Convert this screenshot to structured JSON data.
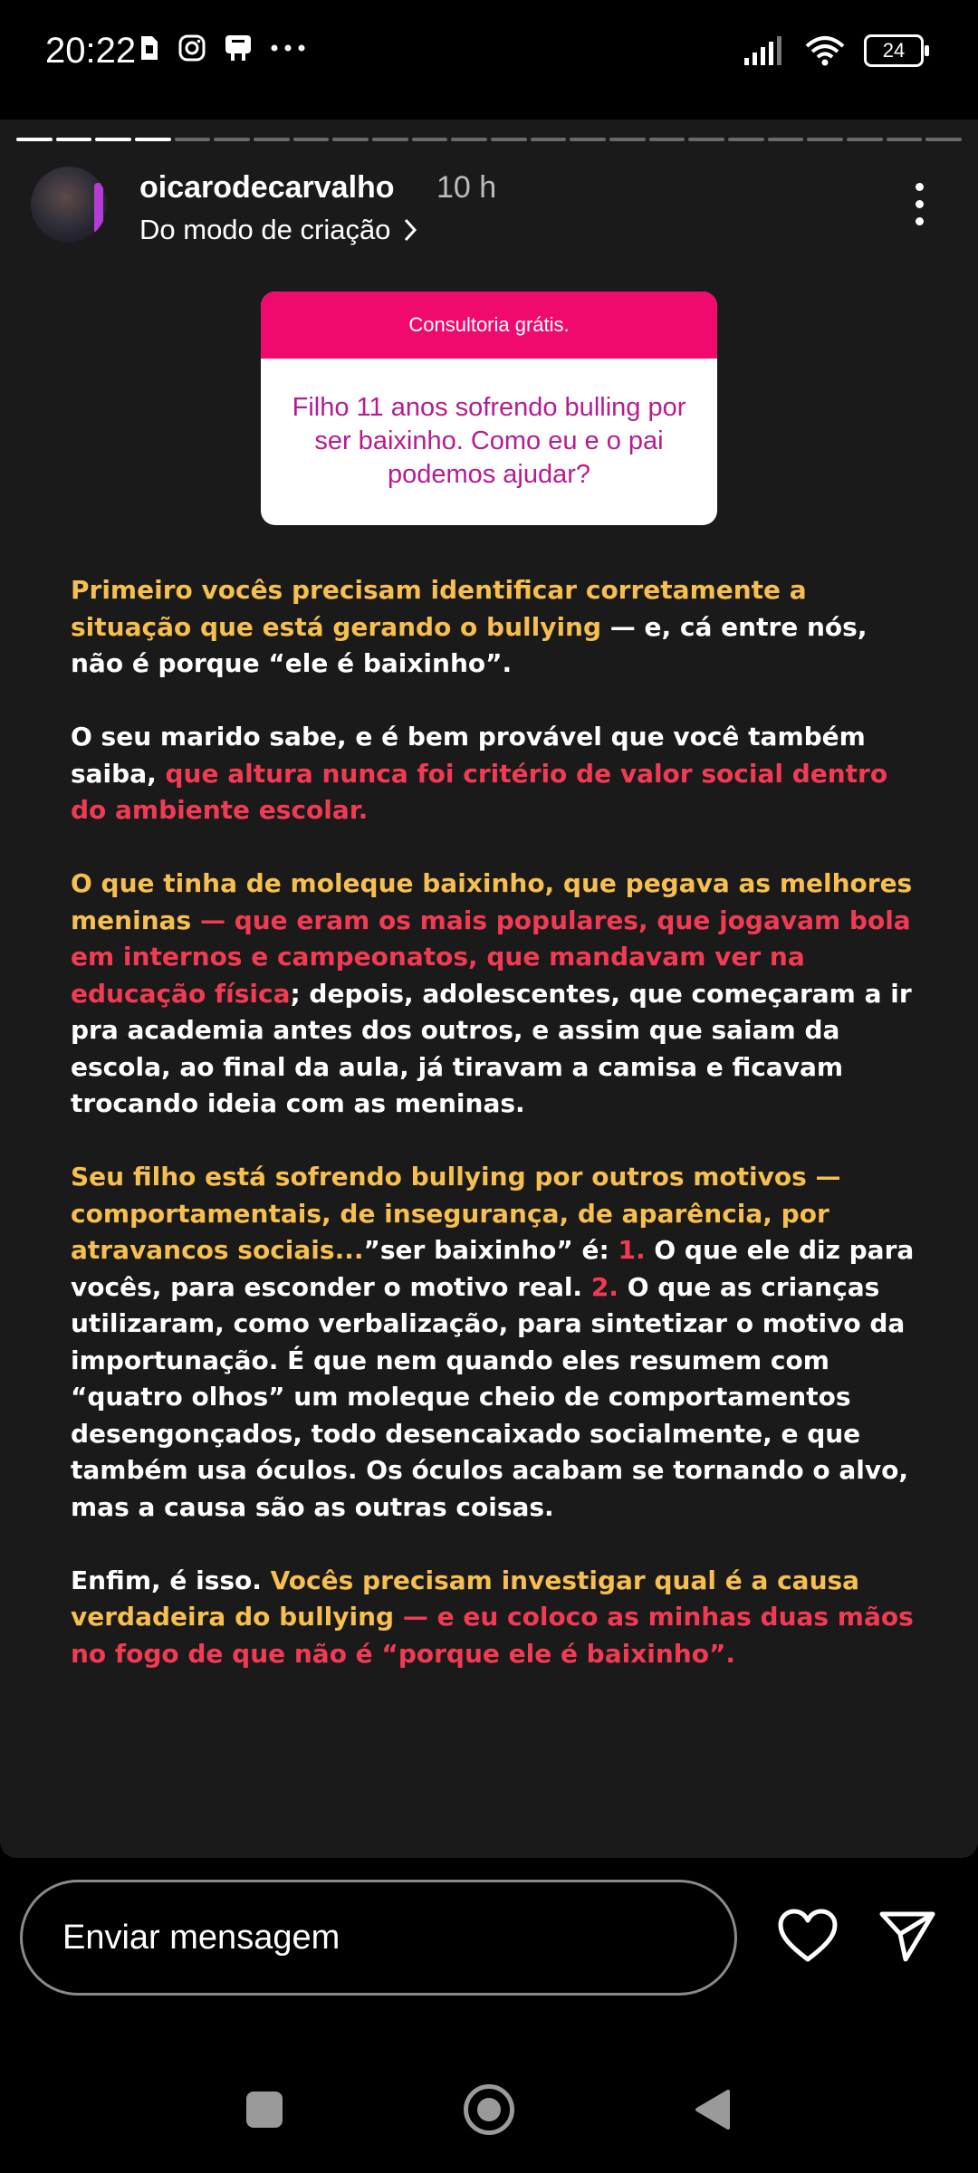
{
  "status_bar": {
    "time": "20:22",
    "battery": "24",
    "left_icons": [
      "sim-card-icon",
      "instagram-icon",
      "notification-icon",
      "more-dots-icon"
    ],
    "right_icons": [
      "signal-icon",
      "wifi-icon",
      "battery-icon"
    ]
  },
  "story": {
    "progress": {
      "total": 24,
      "viewed": 4
    },
    "username": "oicarodecarvalho",
    "time_ago": "10 h",
    "subline": "Do modo de criação",
    "question_box": {
      "header": "Consultoria grátis.",
      "question": "Filho 11 anos sofrendo bulling por ser baixinho. Como eu e o pai podemos ajudar?"
    },
    "paragraphs": {
      "p1": {
        "a": "Primeiro vocês precisam identificar corretamente a situação que está gerando o bullying",
        "b": " — e, cá entre nós, não é porque “ele é baixinho”."
      },
      "p2": {
        "a": "O seu marido sabe, e é bem provável que você também saiba, ",
        "b": "que altura nunca foi critério de valor social dentro do ambiente escolar."
      },
      "p3": {
        "a": "O que tinha de moleque baixinho, que pegava as melhores meninas",
        "b": " — que eram os mais populares, que jogavam bola em internos e campeonatos, que mandavam ver na educação física",
        "c": "; depois, adolescentes, que começaram a ir pra academia antes dos outros, e assim que saiam da escola, ao final da aula, já tiravam a camisa e ficavam trocando ideia com as meninas."
      },
      "p4": {
        "a": "Seu filho está sofrendo bullying por outros motivos — comportamentais, de insegurança, de aparência, por atravancos sociais...",
        "b": "”ser baixinho” é: ",
        "c": "1.",
        "d": " O que ele diz para vocês, para esconder o motivo real. ",
        "e": "2.",
        "f": " O que as crianças utilizaram, como verbalização, para sintetizar o motivo da importunação. É que nem quando eles resumem com “quatro olhos” um moleque cheio de comportamentos desengonçados, todo desencaixado socialmente, e que também usa óculos. Os óculos acabam se tornando o alvo, mas a causa são as outras coisas."
      },
      "p5": {
        "a": "Enfim, é isso. ",
        "b": "Vocês precisam investigar qual é a causa verdadeira do bullying",
        "c": " — e eu coloco as minhas duas mãos no fogo de que não é “porque ele é baixinho”."
      }
    }
  },
  "reply_bar": {
    "placeholder": "Enviar mensagem",
    "like_icon": "heart-icon",
    "share_icon": "send-icon"
  },
  "nav_bar": {
    "buttons": [
      "recents-square-icon",
      "home-circle-icon",
      "back-triangle-icon"
    ]
  },
  "colors": {
    "background": "#1a1a1a",
    "highlight_yellow": "#f6bf4f",
    "highlight_red": "#f23b53",
    "question_header": "#f00a6d",
    "question_text": "#b61c8f"
  }
}
